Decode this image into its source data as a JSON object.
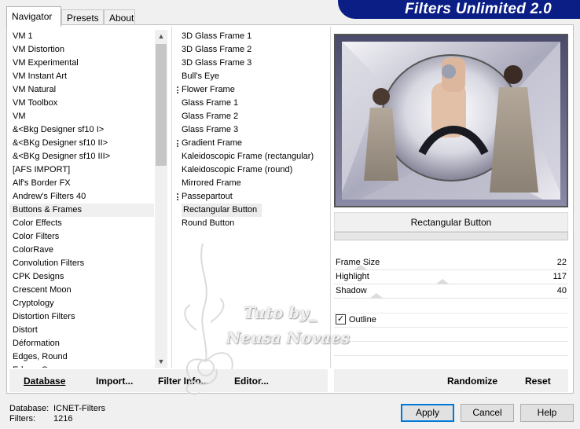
{
  "app": {
    "title": "Filters Unlimited 2.0"
  },
  "tabs": [
    {
      "label": "Navigator",
      "active": true
    },
    {
      "label": "Presets",
      "active": false
    },
    {
      "label": "About",
      "active": false
    }
  ],
  "categories": {
    "selected": "Buttons & Frames",
    "items": [
      "VM 1",
      "VM Distortion",
      "VM Experimental",
      "VM Instant Art",
      "VM Natural",
      "VM Toolbox",
      "VM",
      "&<Bkg Designer sf10 I>",
      "&<BKg Designer sf10 II>",
      "&<BKg Designer sf10 III>",
      "[AFS IMPORT]",
      "Alf's Border FX",
      "Andrew's Filters 40",
      "Buttons & Frames",
      "Color Effects",
      "Color Filters",
      "ColorRave",
      "Convolution Filters",
      "CPK Designs",
      "Crescent Moon",
      "Cryptology",
      "Distortion Filters",
      "Distort",
      "Déformation",
      "Edges, Round",
      "Edges, Square"
    ]
  },
  "filters": {
    "selected": "Rectangular Button",
    "items": [
      {
        "label": "3D Glass Frame 1",
        "preset": false
      },
      {
        "label": "3D Glass Frame 2",
        "preset": false
      },
      {
        "label": "3D Glass Frame 3",
        "preset": false
      },
      {
        "label": "Bull's Eye",
        "preset": false
      },
      {
        "label": "Flower Frame",
        "preset": true
      },
      {
        "label": "Glass Frame 1",
        "preset": false
      },
      {
        "label": "Glass Frame 2",
        "preset": false
      },
      {
        "label": "Glass Frame 3",
        "preset": false
      },
      {
        "label": "Gradient Frame",
        "preset": true
      },
      {
        "label": "Kaleidoscopic Frame (rectangular)",
        "preset": false
      },
      {
        "label": "Kaleidoscopic Frame (round)",
        "preset": false
      },
      {
        "label": "Mirrored Frame",
        "preset": false
      },
      {
        "label": "Passepartout",
        "preset": true
      },
      {
        "label": "Rectangular Button",
        "preset": false
      },
      {
        "label": "Round Button",
        "preset": false
      }
    ]
  },
  "settings": {
    "filter_name": "Rectangular Button",
    "sliders": [
      {
        "label": "Frame Size",
        "value": "22",
        "level": 0.09
      },
      {
        "label": "Highlight",
        "value": "117",
        "level": 0.46
      },
      {
        "label": "Shadow",
        "value": "40",
        "level": 0.16
      }
    ],
    "outline": {
      "label": "Outline",
      "checked": true
    }
  },
  "bottom_left": {
    "database": "Database",
    "import": "Import...",
    "filter_info": "Filter Info...",
    "editor": "Editor..."
  },
  "bottom_right": {
    "randomize": "Randomize",
    "reset": "Reset"
  },
  "status": {
    "database_label": "Database:",
    "database_value": "ICNET-Filters",
    "filters_label": "Filters:",
    "filters_value": "1216"
  },
  "buttons": {
    "apply": "Apply",
    "cancel": "Cancel",
    "help": "Help"
  },
  "watermark": {
    "line1": "Tuto by_",
    "line2": "Neusa Novaes"
  },
  "colors": {
    "banner": "#0a1e86",
    "default_button_border": "#0078d7"
  }
}
